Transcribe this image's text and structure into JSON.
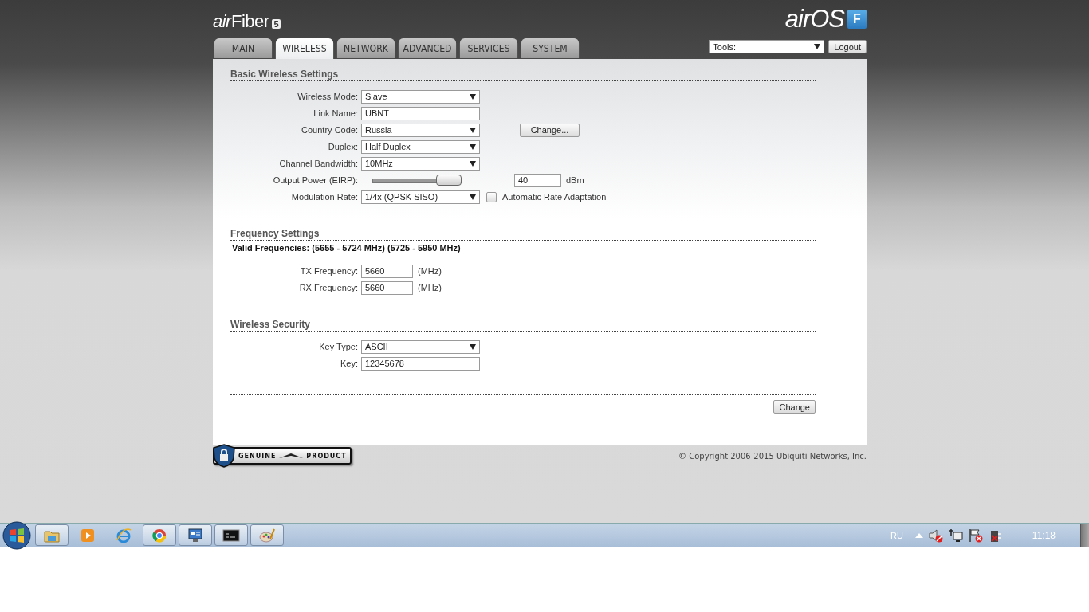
{
  "header": {
    "product_logo": "airFiber",
    "product_badge": "5",
    "os_logo": "airOS",
    "os_badge": "F"
  },
  "tabs": [
    {
      "label": "MAIN",
      "selected": false
    },
    {
      "label": "WIRELESS",
      "selected": true
    },
    {
      "label": "NETWORK",
      "selected": false
    },
    {
      "label": "ADVANCED",
      "selected": false
    },
    {
      "label": "SERVICES",
      "selected": false
    },
    {
      "label": "SYSTEM",
      "selected": false
    }
  ],
  "tools": {
    "value": "Tools:"
  },
  "logout": "Logout",
  "sections": [
    {
      "title": "Basic Wireless Settings",
      "rows": [
        {
          "kind": "select",
          "label": "Wireless Mode:",
          "value": "Slave"
        },
        {
          "kind": "text",
          "label": "Link Name:",
          "value": "UBNT"
        },
        {
          "kind": "select",
          "label": "Country Code:",
          "value": "Russia",
          "button": "Change..."
        },
        {
          "kind": "select",
          "label": "Duplex:",
          "value": "Half Duplex"
        },
        {
          "kind": "select",
          "label": "Channel Bandwidth:",
          "value": "10MHz"
        },
        {
          "kind": "slider",
          "label": "Output Power (EIRP):",
          "level": 0.85,
          "value": "40",
          "unit": "dBm"
        },
        {
          "kind": "select",
          "label": "Modulation Rate:",
          "value": "1/4x (QPSK SISO)",
          "checkbox": {
            "label": "Automatic Rate Adaptation",
            "checked": false
          }
        }
      ]
    },
    {
      "title": "Frequency Settings",
      "note": "Valid Frequencies: (5655 - 5724 MHz) (5725 - 5950 MHz)",
      "rows": [
        {
          "kind": "short",
          "label": "TX Frequency:",
          "value": "5660",
          "unit": "(MHz)"
        },
        {
          "kind": "short",
          "label": "RX Frequency:",
          "value": "5660",
          "unit": "(MHz)"
        }
      ]
    },
    {
      "title": "Wireless Security",
      "rows": [
        {
          "kind": "select",
          "label": "Key Type:",
          "value": "ASCII"
        },
        {
          "kind": "text",
          "label": "Key:",
          "value": "12345678"
        }
      ]
    }
  ],
  "change_button": "Change",
  "genuine_badge": {
    "left": "GENUINE",
    "right": "PRODUCT"
  },
  "copyright": "© Copyright 2006-2015 Ubiquiti Networks, Inc.",
  "taskbar": {
    "language": "RU",
    "clock": "11:18"
  }
}
